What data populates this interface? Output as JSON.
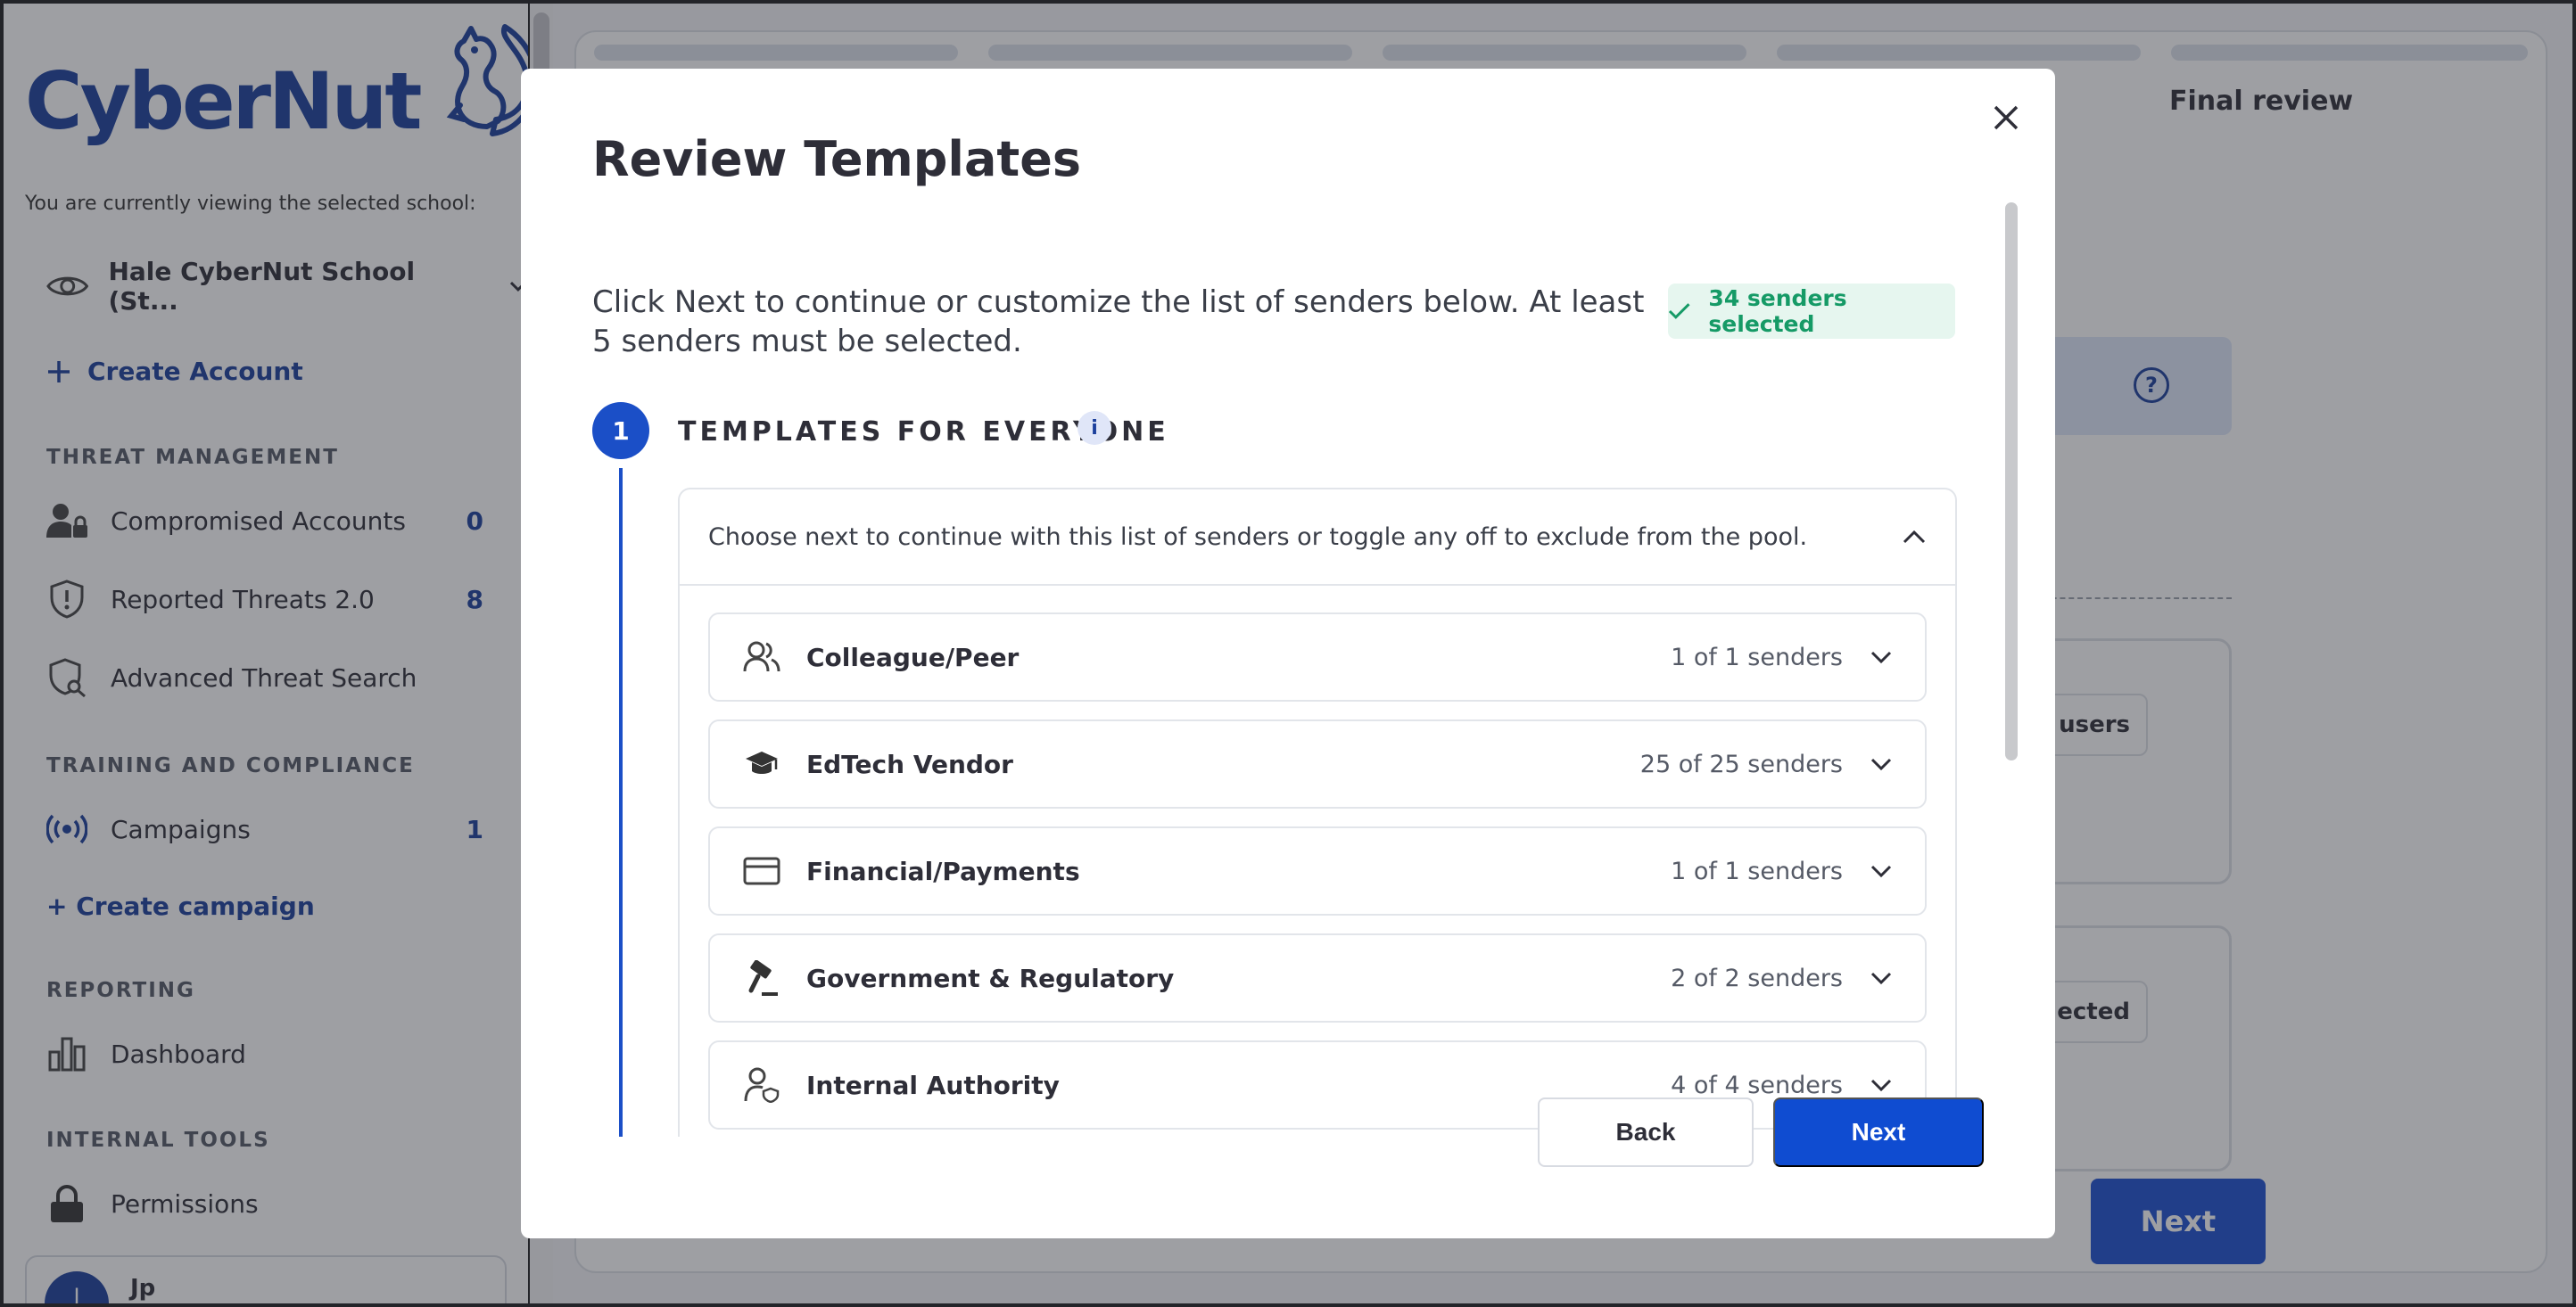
{
  "sidebar": {
    "logo_text": "CyberNut",
    "viewing_label": "You are currently viewing the selected school:",
    "school_name": "Hale CyberNut School (St...",
    "create_account": "Create Account",
    "sections": {
      "threat": "THREAT MANAGEMENT",
      "training": "TRAINING AND COMPLIANCE",
      "reporting": "REPORTING",
      "internal": "INTERNAL TOOLS"
    },
    "items": {
      "compromised": {
        "label": "Compromised Accounts",
        "count": "0"
      },
      "reported": {
        "label": "Reported Threats 2.0",
        "count": "8"
      },
      "advanced": {
        "label": "Advanced Threat Search"
      },
      "campaigns": {
        "label": "Campaigns",
        "count": "1"
      },
      "dashboard": {
        "label": "Dashboard"
      },
      "permissions": {
        "label": "Permissions"
      }
    },
    "create_campaign": "+ Create campaign",
    "user": {
      "initial": "J",
      "name": "Jp"
    }
  },
  "background": {
    "final_review": "Final review",
    "help_glyph": "?",
    "card1_btn": "users",
    "card2_btn": "ected",
    "next": "Next"
  },
  "modal": {
    "title": "Review Templates",
    "description": "Click Next to continue or customize the list of senders below. At least 5 senders must be selected.",
    "badge": "34 senders selected",
    "step_number": "1",
    "step_title": "TEMPLATES FOR EVERYONE",
    "info_glyph": "i",
    "accordion_header": "Choose next to continue with this list of senders or toggle any off to exclude from the pool.",
    "categories": [
      {
        "name": "Colleague/Peer",
        "count": "1 of 1 senders",
        "icon": "users-icon"
      },
      {
        "name": "EdTech Vendor",
        "count": "25 of 25 senders",
        "icon": "graduation-cap-icon"
      },
      {
        "name": "Financial/Payments",
        "count": "1 of 1 senders",
        "icon": "credit-card-icon"
      },
      {
        "name": "Government & Regulatory",
        "count": "2 of 2 senders",
        "icon": "gavel-icon"
      },
      {
        "name": "Internal Authority",
        "count": "4 of 4 senders",
        "icon": "user-shield-icon"
      }
    ],
    "back": "Back",
    "next": "Next"
  },
  "colors": {
    "brand": "#1b3f9c",
    "primary_button": "#0f4cd1",
    "success": "#159a66"
  }
}
